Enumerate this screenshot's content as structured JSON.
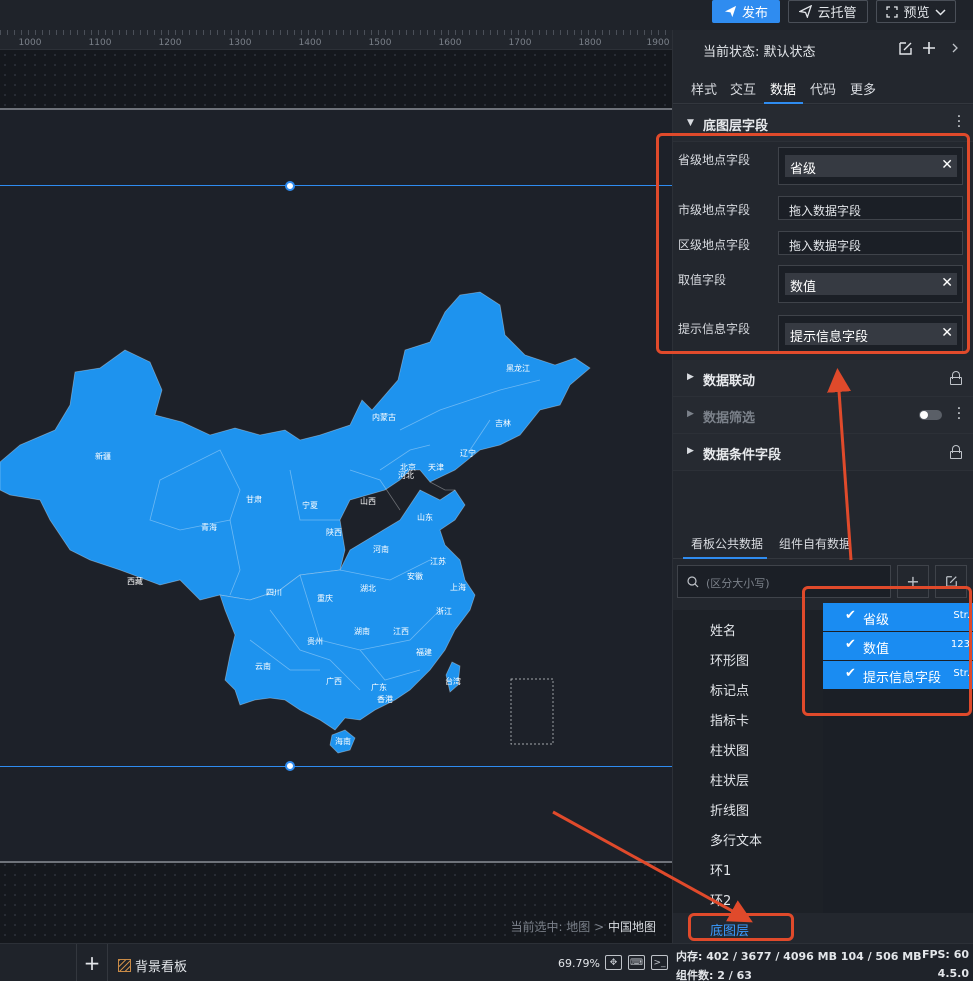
{
  "toolbar": {
    "publish_label": "发布",
    "cloud_label": "云托管",
    "preview_label": "预览"
  },
  "ruler": {
    "ticks": [
      "1000",
      "1100",
      "1200",
      "1300",
      "1400",
      "1500",
      "1600",
      "1700",
      "1800",
      "1900"
    ]
  },
  "map": {
    "provinces": [
      "黑龙江",
      "吉林",
      "辽宁",
      "内蒙古",
      "新疆",
      "甘肃",
      "宁夏",
      "北京",
      "天津",
      "河北",
      "山西",
      "山东",
      "青海",
      "陕西",
      "河南",
      "江苏",
      "安徽",
      "上海",
      "西藏",
      "四川",
      "重庆",
      "湖北",
      "浙江",
      "贵州",
      "湖南",
      "江西",
      "云南",
      "福建",
      "台湾",
      "广西",
      "广东",
      "香港",
      "海南"
    ],
    "fill_color": "#1e93ee"
  },
  "canvas": {
    "breadcrumb_prefix": "当前选中: ",
    "breadcrumb_path": "地图 > ",
    "breadcrumb_current": "中国地图"
  },
  "bottom": {
    "board_tab": "背景看板",
    "zoom": "69.79%"
  },
  "panel": {
    "state_label": "当前状态: ",
    "state_value": "默认状态",
    "tabs": [
      "样式",
      "交互",
      "数据",
      "代码",
      "更多"
    ],
    "active_tab": "数据",
    "sections": {
      "base_layer": "底图层字段",
      "linkage": "数据联动",
      "filter": "数据筛选",
      "condition": "数据条件字段"
    },
    "fields": [
      {
        "label": "省级地点字段",
        "value": "省级",
        "filled": true
      },
      {
        "label": "市级地点字段",
        "value": "拖入数据字段",
        "filled": false
      },
      {
        "label": "区级地点字段",
        "value": "拖入数据字段",
        "filled": false
      },
      {
        "label": "取值字段",
        "value": "数值",
        "filled": true
      },
      {
        "label": "提示信息字段",
        "value": "提示信息字段",
        "filled": true
      }
    ],
    "data_tabs": [
      "看板公共数据",
      "组件自有数据"
    ],
    "search_placeholder": "(区分大小写)",
    "datasets": [
      "姓名",
      "环形图",
      "标记点",
      "指标卡",
      "柱状图",
      "柱状层",
      "折线图",
      "多行文本",
      "环1",
      "环2",
      "底图层"
    ],
    "active_dataset": "底图层",
    "dataset_fields": [
      {
        "name": "省级",
        "type": "Str."
      },
      {
        "name": "数值",
        "type": "123"
      },
      {
        "name": "提示信息字段",
        "type": "Str."
      }
    ]
  },
  "status": {
    "memory_label": "内存:",
    "memory_value": "402 / 3677 / 4096 MB  104 / 506 MB",
    "fps_label": "FPS:",
    "fps_value": "60",
    "components_label": "组件数:",
    "components_value": "2 / 63",
    "version": "4.5.0"
  },
  "colors": {
    "accent": "#2f8cf0",
    "highlight": "#e04a2b"
  }
}
